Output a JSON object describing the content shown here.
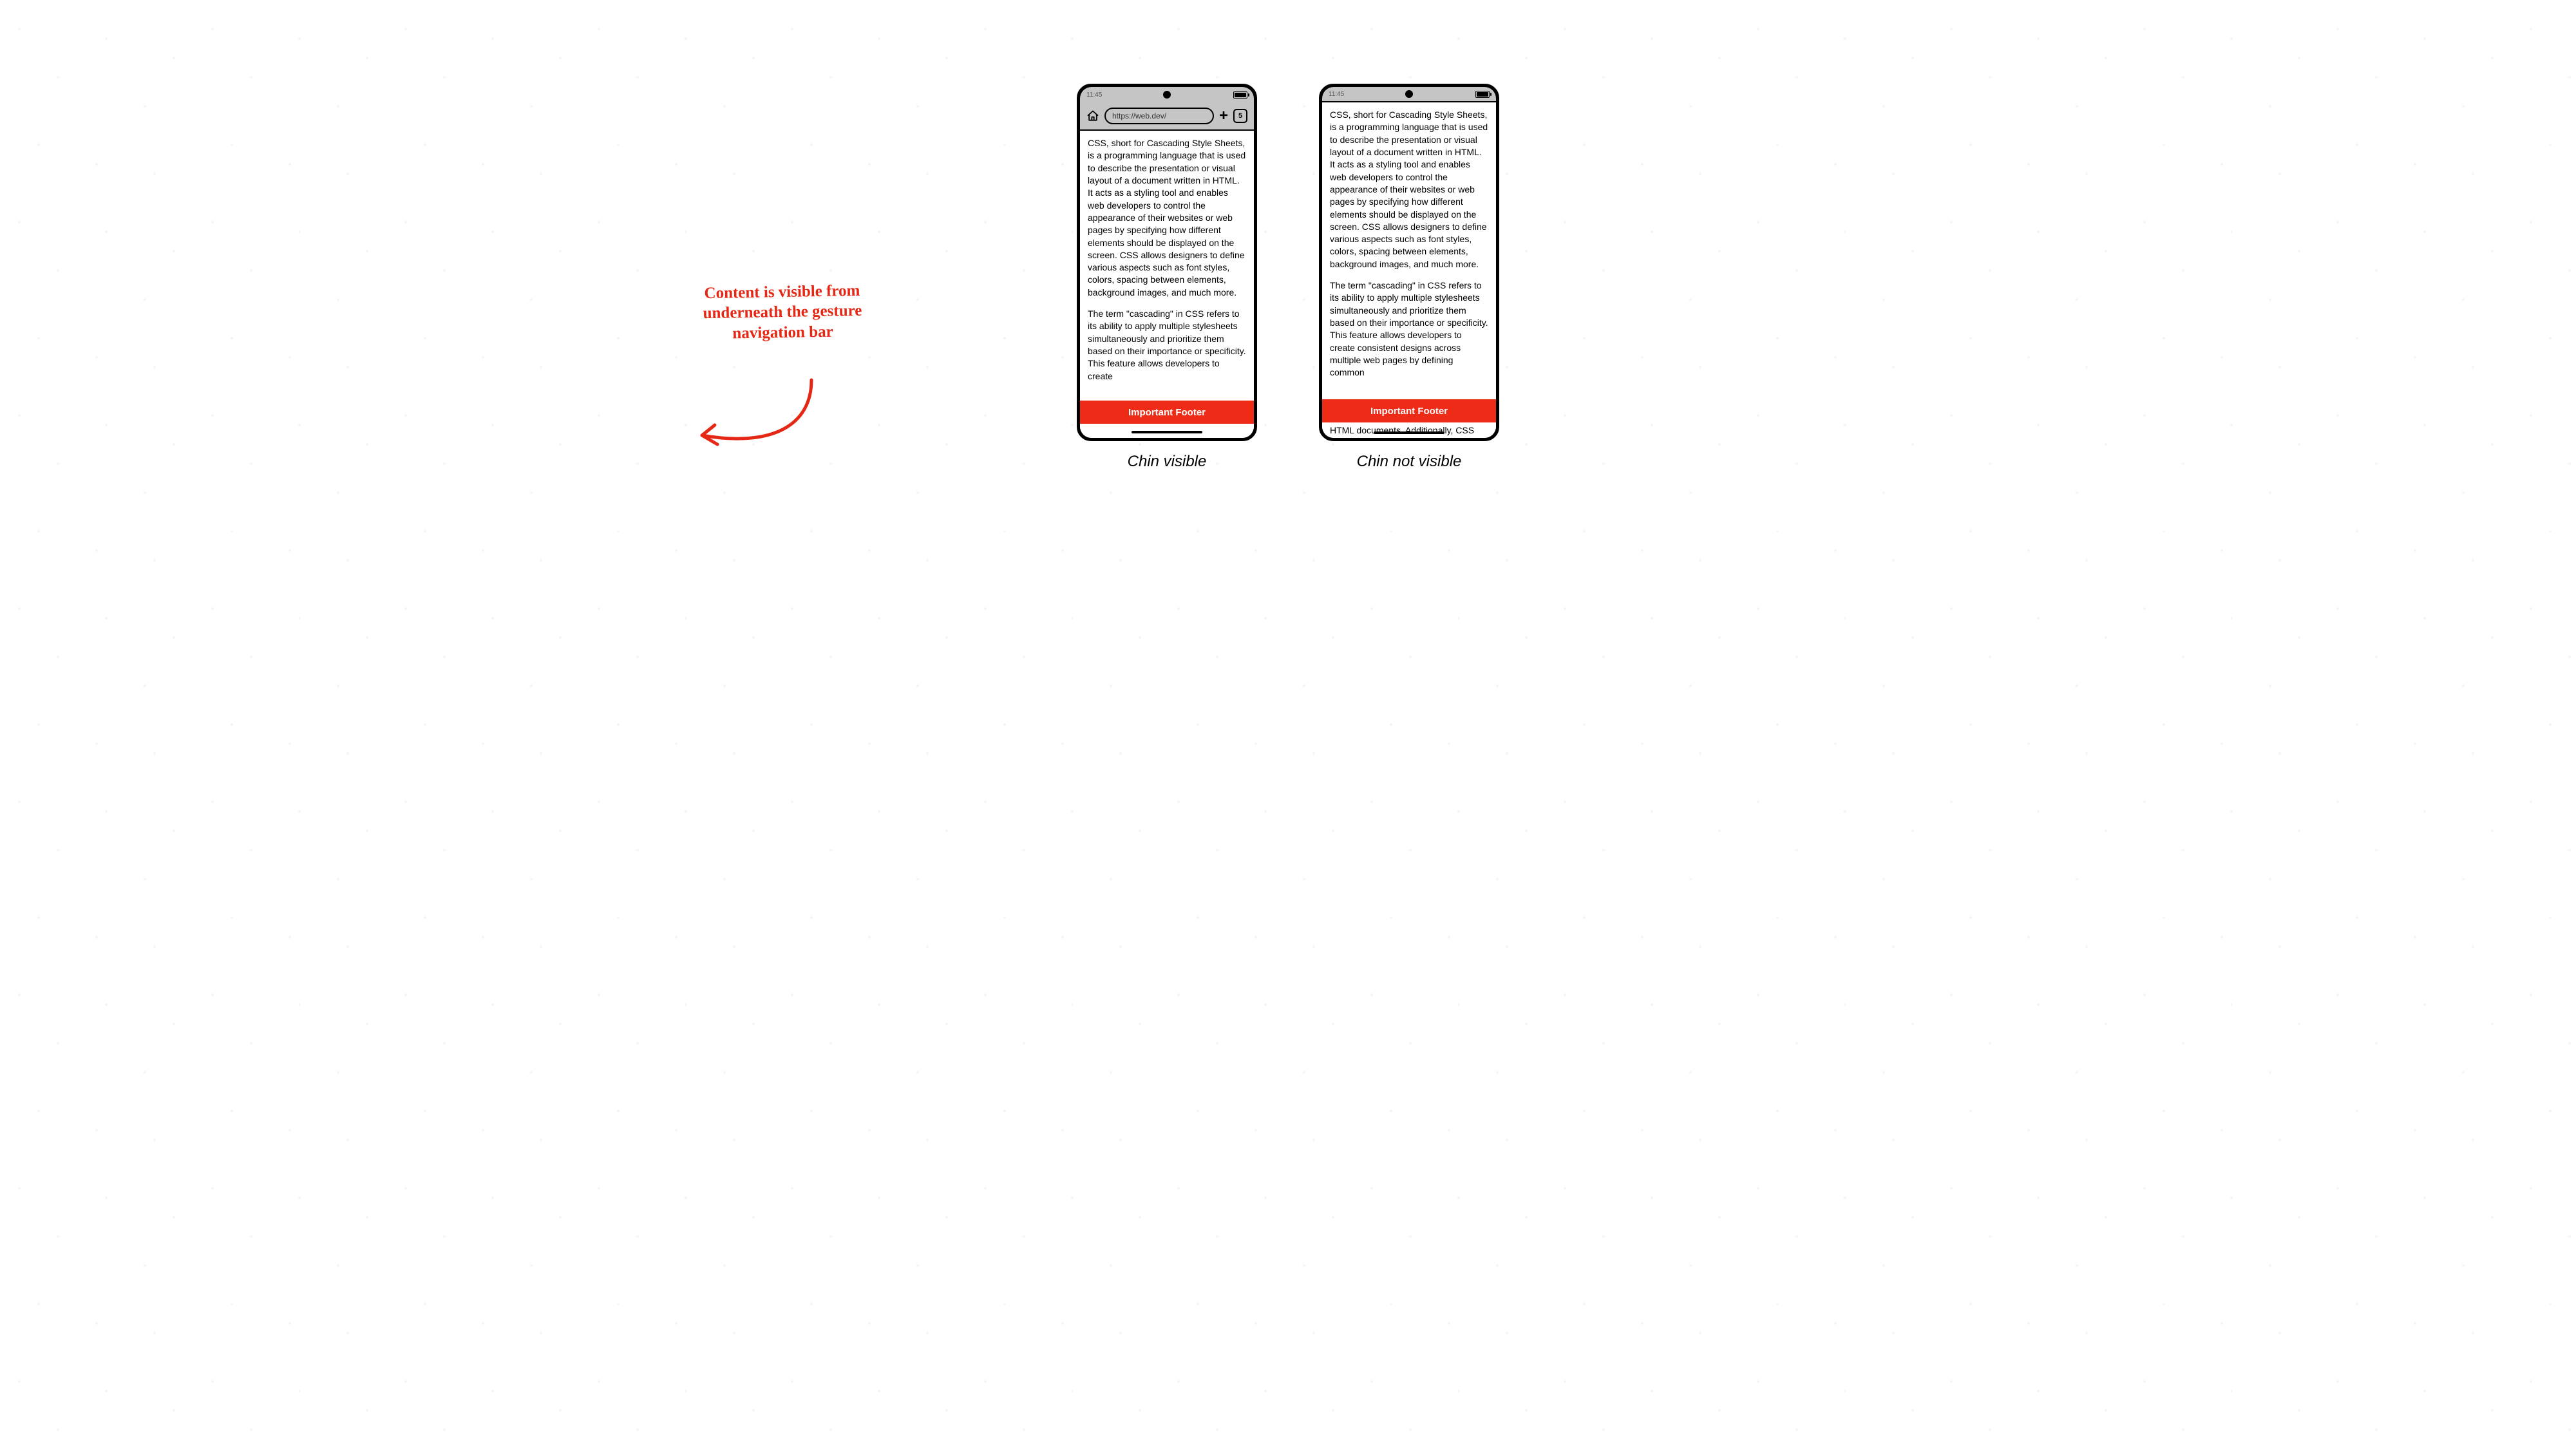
{
  "statusbar": {
    "time": "11:45"
  },
  "browser": {
    "url": "https://web.dev/",
    "tab_count": "5"
  },
  "content": {
    "para1": "CSS, short for Cascading Style Sheets, is a programming language that is used to describe the presentation or visual layout of a document written in HTML. It acts as a styling tool and enables web developers to control the appearance of their websites or web pages by specifying how different elements should be displayed on the screen. CSS allows designers to define various aspects such as font styles, colors, spacing between elements, background images, and much more.",
    "para2_left": "The term \"cascading\" in CSS refers to its ability to apply multiple stylesheets simultaneously and prioritize them based on their importance or specificity. This feature allows developers to create",
    "para2_right": "The term \"cascading\" in CSS refers to its ability to apply multiple stylesheets simultaneously and prioritize them based on their importance or specificity. This feature allows developers to create consistent designs across multiple web pages by defining common",
    "peek_right": "HTML documents. Additionally, CSS"
  },
  "footer": {
    "label": "Important Footer",
    "color": "#ed2b17"
  },
  "captions": {
    "left": "Chin visible",
    "right": "Chin not visible"
  },
  "annotation": {
    "text": "Content is visible from underneath the gesture navigation bar"
  }
}
